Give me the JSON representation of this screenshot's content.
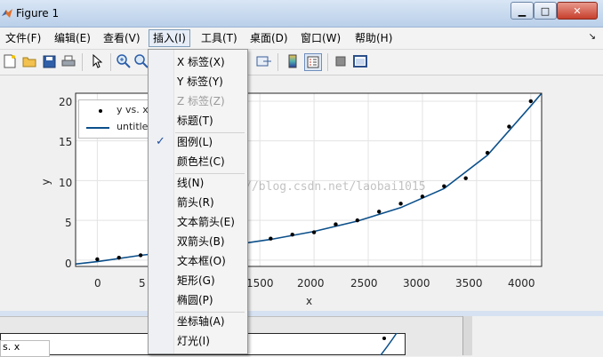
{
  "window": {
    "title": "Figure 1",
    "controls": {
      "minimize": "▁",
      "maximize": "□",
      "close": "✕"
    }
  },
  "menubar": {
    "items": [
      {
        "label": "文件(F)"
      },
      {
        "label": "编辑(E)"
      },
      {
        "label": "查看(V)"
      },
      {
        "label": "插入(I)",
        "active": true
      },
      {
        "label": "工具(T)"
      },
      {
        "label": "桌面(D)"
      },
      {
        "label": "窗口(W)"
      },
      {
        "label": "帮助(H)"
      }
    ],
    "dock_arrow": "↘"
  },
  "toolbar": {
    "icons": [
      "new-figure-icon",
      "open-icon",
      "save-icon",
      "print-icon",
      "pointer-icon",
      "zoom-in-icon",
      "zoom-out-icon",
      "link-icon",
      "colorbar-icon",
      "legend-icon",
      "hide-tools-icon",
      "show-tools-icon"
    ]
  },
  "insert_menu": {
    "items": [
      {
        "label": "X 标签(X)"
      },
      {
        "label": "Y 标签(Y)"
      },
      {
        "label": "Z 标签(Z)",
        "disabled": true
      },
      {
        "label": "标题(T)"
      },
      {
        "label": "图例(L)",
        "checked": true
      },
      {
        "label": "颜色栏(C)"
      },
      {
        "label": "线(N)"
      },
      {
        "label": "箭头(R)"
      },
      {
        "label": "文本箭头(E)"
      },
      {
        "label": "双箭头(B)"
      },
      {
        "label": "文本框(O)"
      },
      {
        "label": "矩形(G)"
      },
      {
        "label": "椭圆(P)"
      },
      {
        "label": "坐标轴(A)"
      },
      {
        "label": "灯光(I)"
      }
    ],
    "check_mark": "✓"
  },
  "chart_data": {
    "type": "scatter",
    "xlabel": "x",
    "ylabel": "y",
    "xlim": [
      -200,
      4100
    ],
    "ylim": [
      -0.8,
      21
    ],
    "xticks_visible": [
      "0",
      "5",
      "1500",
      "2000",
      "2500",
      "3000",
      "3500",
      "4000"
    ],
    "yticks": [
      "0",
      "5",
      "10",
      "15",
      "20"
    ],
    "grid": true,
    "legend": {
      "placement": "top-left",
      "entries": [
        "y vs. x",
        "untitle"
      ]
    },
    "series": [
      {
        "name": "y vs. x",
        "style": "points",
        "color": "#000000",
        "x": [
          0,
          200,
          400,
          1600,
          1800,
          2000,
          2200,
          2400,
          2600,
          2800,
          3000,
          3200,
          3400,
          3600,
          3800,
          4000
        ],
        "y": [
          0.1,
          0.3,
          0.6,
          2.7,
          3.2,
          3.5,
          4.5,
          5.0,
          6.1,
          7.1,
          8.0,
          9.3,
          10.3,
          13.5,
          16.8,
          20.0
        ]
      },
      {
        "name": "untitle",
        "style": "line",
        "color": "#0b4f8a",
        "x": [
          -200,
          0,
          400,
          800,
          1200,
          1600,
          2000,
          2400,
          2800,
          3200,
          3600,
          4000,
          4100
        ],
        "y": [
          -0.5,
          -0.2,
          0.6,
          1.2,
          1.8,
          2.6,
          3.6,
          4.9,
          6.6,
          9.0,
          13.2,
          19.4,
          21
        ]
      }
    ]
  },
  "background_window": {
    "legend_text": "s. x"
  },
  "watermark": "http://blog.csdn.net/laobai1015"
}
